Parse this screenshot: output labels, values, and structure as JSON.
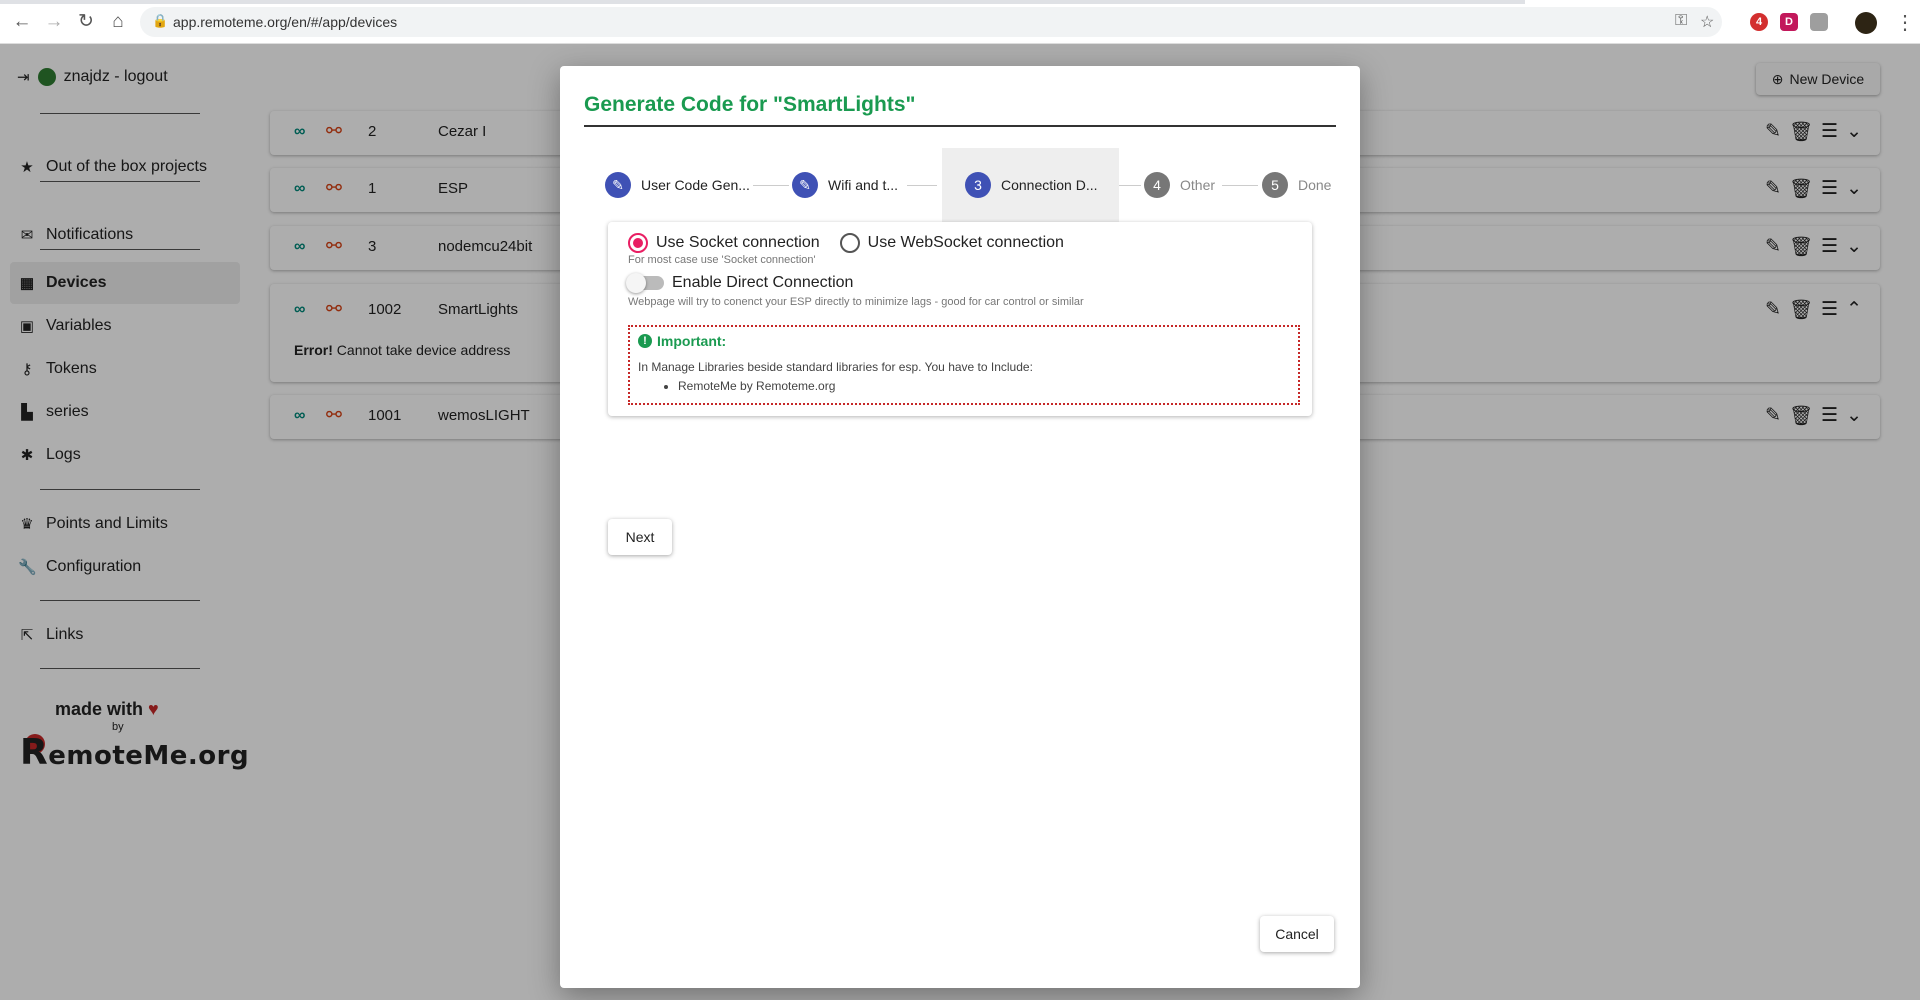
{
  "browser": {
    "url": "app.remoteme.org/en/#/app/devices",
    "ext_badge": "4",
    "ext_d": "D"
  },
  "sidebar": {
    "user_label": "znajdz - logout",
    "items": [
      {
        "label": "Out of the box projects",
        "icon": "star-icon"
      },
      {
        "label": "Notifications",
        "icon": "envelope-icon"
      },
      {
        "label": "Devices",
        "icon": "chip-icon"
      },
      {
        "label": "Variables",
        "icon": "variable-icon"
      },
      {
        "label": "Tokens",
        "icon": "key-icon"
      },
      {
        "label": "series",
        "icon": "chart-icon"
      },
      {
        "label": "Logs",
        "icon": "bug-icon"
      },
      {
        "label": "Points and Limits",
        "icon": "trophy-icon"
      },
      {
        "label": "Configuration",
        "icon": "wrench-icon"
      },
      {
        "label": "Links",
        "icon": "external-link-icon"
      }
    ],
    "made_with": "made with",
    "by": "by",
    "logo_r": "R",
    "logo_rest": "emoteMe.org"
  },
  "toolbar": {
    "new_device_label": "New Device"
  },
  "devices": [
    {
      "id": "2",
      "name": "Cezar I"
    },
    {
      "id": "1",
      "name": "ESP"
    },
    {
      "id": "3",
      "name": "nodemcu24bit"
    },
    {
      "id": "1002",
      "name": "SmartLights",
      "error_strong": "Error!",
      "error_text": " Cannot take device address"
    },
    {
      "id": "1001",
      "name": "wemosLIGHT"
    }
  ],
  "modal": {
    "title": "Generate Code for \"SmartLights\"",
    "steps": [
      {
        "num": "",
        "label": "User Code Gen..."
      },
      {
        "num": "",
        "label": "Wifi and t..."
      },
      {
        "num": "3",
        "label": "Connection D..."
      },
      {
        "num": "4",
        "label": "Other"
      },
      {
        "num": "5",
        "label": "Done"
      }
    ],
    "socket_label": "Use Socket connection",
    "websocket_label": "Use WebSocket connection",
    "socket_hint": "For most case use 'Socket connection'",
    "direct_label": "Enable Direct Connection",
    "direct_hint": "Webpage will try to conenct your ESP directly to minimize lags - good for car control or similar",
    "important_title": "Important:",
    "important_text": "In Manage Libraries beside standard libraries for esp. You have to Include:",
    "important_item": "RemoteMe by Remoteme.org",
    "next_label": "Next",
    "cancel_label": "Cancel"
  },
  "colors": {
    "accent": "#1a9a50",
    "step_active": "#3f51b5",
    "radio": "#e91e63",
    "link_ok": "#00897b",
    "link_broken": "#d84315"
  }
}
